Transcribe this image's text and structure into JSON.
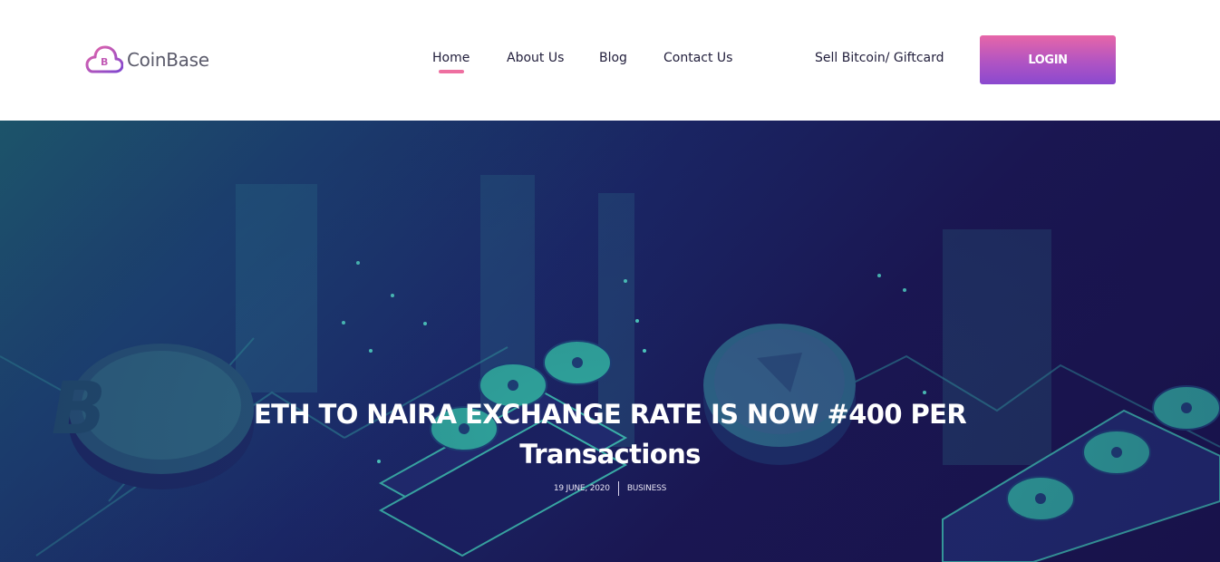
{
  "brand": {
    "name": "CoinBase",
    "accent": "#b054c3",
    "accent_pink": "#e766a8"
  },
  "nav": {
    "items": [
      {
        "label": "Home",
        "active": true
      },
      {
        "label": "About Us",
        "active": false
      },
      {
        "label": "Blog",
        "active": false
      },
      {
        "label": "Contact Us",
        "active": false
      }
    ],
    "sell_link": "Sell Bitcoin/ Giftcard",
    "login_label": "LOGIN"
  },
  "hero": {
    "title_line1": "ETH TO NAIRA EXCHANGE RATE IS NOW #400 PER",
    "title_line2": "Transactions",
    "date": "19 JUNE, 2020",
    "category": "BUSINESS",
    "background_colors": [
      "#1e6a75",
      "#1b2a6a",
      "#18124a"
    ]
  },
  "icons": {
    "logo": "cloud-bitcoin-icon",
    "coin_left": "bitcoin-coin-icon",
    "coin_right": "crypto-coin-icon",
    "fans": "mining-fan-icon"
  }
}
